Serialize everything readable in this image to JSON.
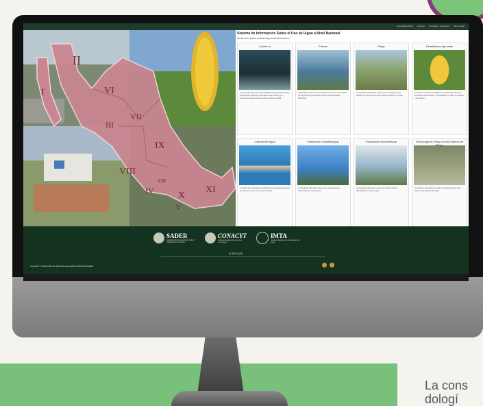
{
  "screen": {
    "nav": [
      "Hotel Plaza Plaza",
      "Conocer",
      "Consultar y programar",
      "Plaza Sacar"
    ],
    "title": "Sistema de Información Sobre el Uso del Agua a Nivel Nacional",
    "subtitle": "Se dan tres pasos cuando llega esta información.",
    "cards": [
      {
        "title": "Acuíferos",
        "desc": "Consulta la cartera de disponibilidad media anual de agua subterránea. Obtenga información del acuífero y el volumen de agua concesionada de cada entidad.",
        "thumb": "aquifer"
      },
      {
        "title": "Presas",
        "desc": "Consulta los volúmenes de almacenamiento y los niveles de agua de las principales presas de la República Mexicana.",
        "thumb": "dam"
      },
      {
        "title": "Riego",
        "desc": "Consulta la información sobre el uso del agua en los distritos de riego de los que se tiene registro en el país.",
        "thumb": "irrigation"
      },
      {
        "title": "Estadísticas Agrícolas",
        "desc": "Consulta los últimos resultados de producción agrícola: superficies sembradas y cosechadas por ciclo, por estado y por cultivo.",
        "thumb": "corn"
      },
      {
        "title": "Calidad del Agua",
        "desc": "Consulta los principales parámetros de la calidad del agua por sitio de monitoreo a nivel nacional.",
        "thumb": "water"
      },
      {
        "title": "Estaciones Climatológicas",
        "desc": "Consulta las diferentes estaciones climatológicas distribuidas en todo el país.",
        "thumb": "station"
      },
      {
        "title": "Estaciones Hidrométricas",
        "desc": "Consulta las diferentes estaciones hidrométricas distribuidas en todo el país.",
        "thumb": "hydro"
      },
      {
        "title": "Tecnología de Riego en los Distritos de Riego",
        "desc": "Consulta el inventario de obras de infraestructura para riego en los distritos de riego.",
        "thumb": "canal"
      }
    ],
    "regions": [
      "I",
      "II",
      "III",
      "IV",
      "V",
      "VI",
      "VII",
      "VIII",
      "IX",
      "X",
      "XI",
      "XIII"
    ],
    "logos": [
      {
        "name": "SADER",
        "sub": "SECRETARÍA DE AGRICULTURA Y DESARROLLO RURAL"
      },
      {
        "name": "CONACYT",
        "sub": "Consejo Nacional de Ciencia y Tecnología"
      },
      {
        "name": "IMTA",
        "sub": "Instituto Mexicano de Tecnología del Agua"
      }
    ],
    "footer_link": "ACERCA DE",
    "copyright": "Copyright © 2020 todos los derechos reservados CONAGUA SADER"
  },
  "side_text": "La cons\ndologí",
  "colors": {
    "footer": "#13321f",
    "topbar": "#1f3b2c",
    "band": "#79c07a",
    "map": "#c98591",
    "social": "#c79a3c"
  }
}
